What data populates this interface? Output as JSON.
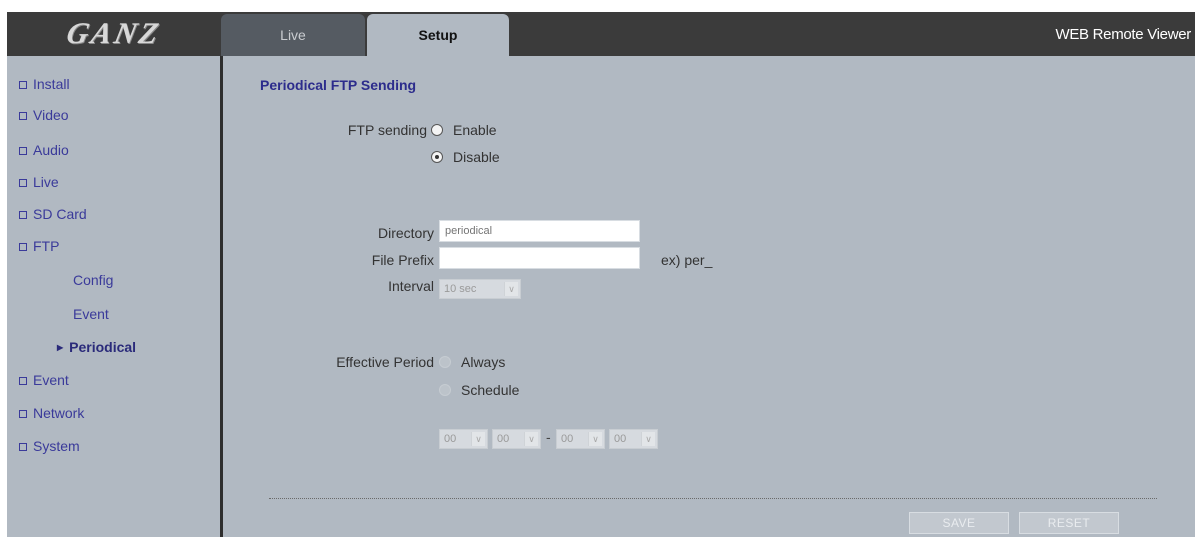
{
  "header": {
    "logo_text": "GANZ",
    "tabs": [
      {
        "label": "Live"
      },
      {
        "label": "Setup"
      }
    ],
    "viewer_title": "WEB Remote Viewer"
  },
  "sidebar": {
    "items": [
      {
        "label": "Install"
      },
      {
        "label": "Video"
      },
      {
        "label": "Audio"
      },
      {
        "label": "Live"
      },
      {
        "label": "SD Card"
      },
      {
        "label": "FTP"
      },
      {
        "label": "Config"
      },
      {
        "label": "Event"
      },
      {
        "label": "Periodical"
      },
      {
        "label": "Event"
      },
      {
        "label": "Network"
      },
      {
        "label": "System"
      }
    ],
    "active_item": "Periodical"
  },
  "main": {
    "title": "Periodical FTP Sending",
    "ftp_sending": {
      "label": "FTP sending",
      "options": [
        "Enable",
        "Disable"
      ],
      "selected": "Disable"
    },
    "directory": {
      "label": "Directory",
      "placeholder": "periodical"
    },
    "file_prefix": {
      "label": "File Prefix",
      "value": "",
      "hint": "ex) per_"
    },
    "interval": {
      "label": "Interval",
      "value": "10 sec"
    },
    "effective_period": {
      "label": "Effective Period",
      "options": [
        "Always",
        "Schedule"
      ],
      "schedule": {
        "start_hour": "00",
        "start_min": "00",
        "separator": "-",
        "end_hour": "00",
        "end_min": "00"
      }
    },
    "buttons": {
      "save": "SAVE",
      "reset": "RESET"
    }
  },
  "colors": {
    "panel_bg": "#b1b9c2",
    "frame_dark": "#2e2e2e",
    "link": "#3a3a9a",
    "title": "#2c2c8c"
  }
}
